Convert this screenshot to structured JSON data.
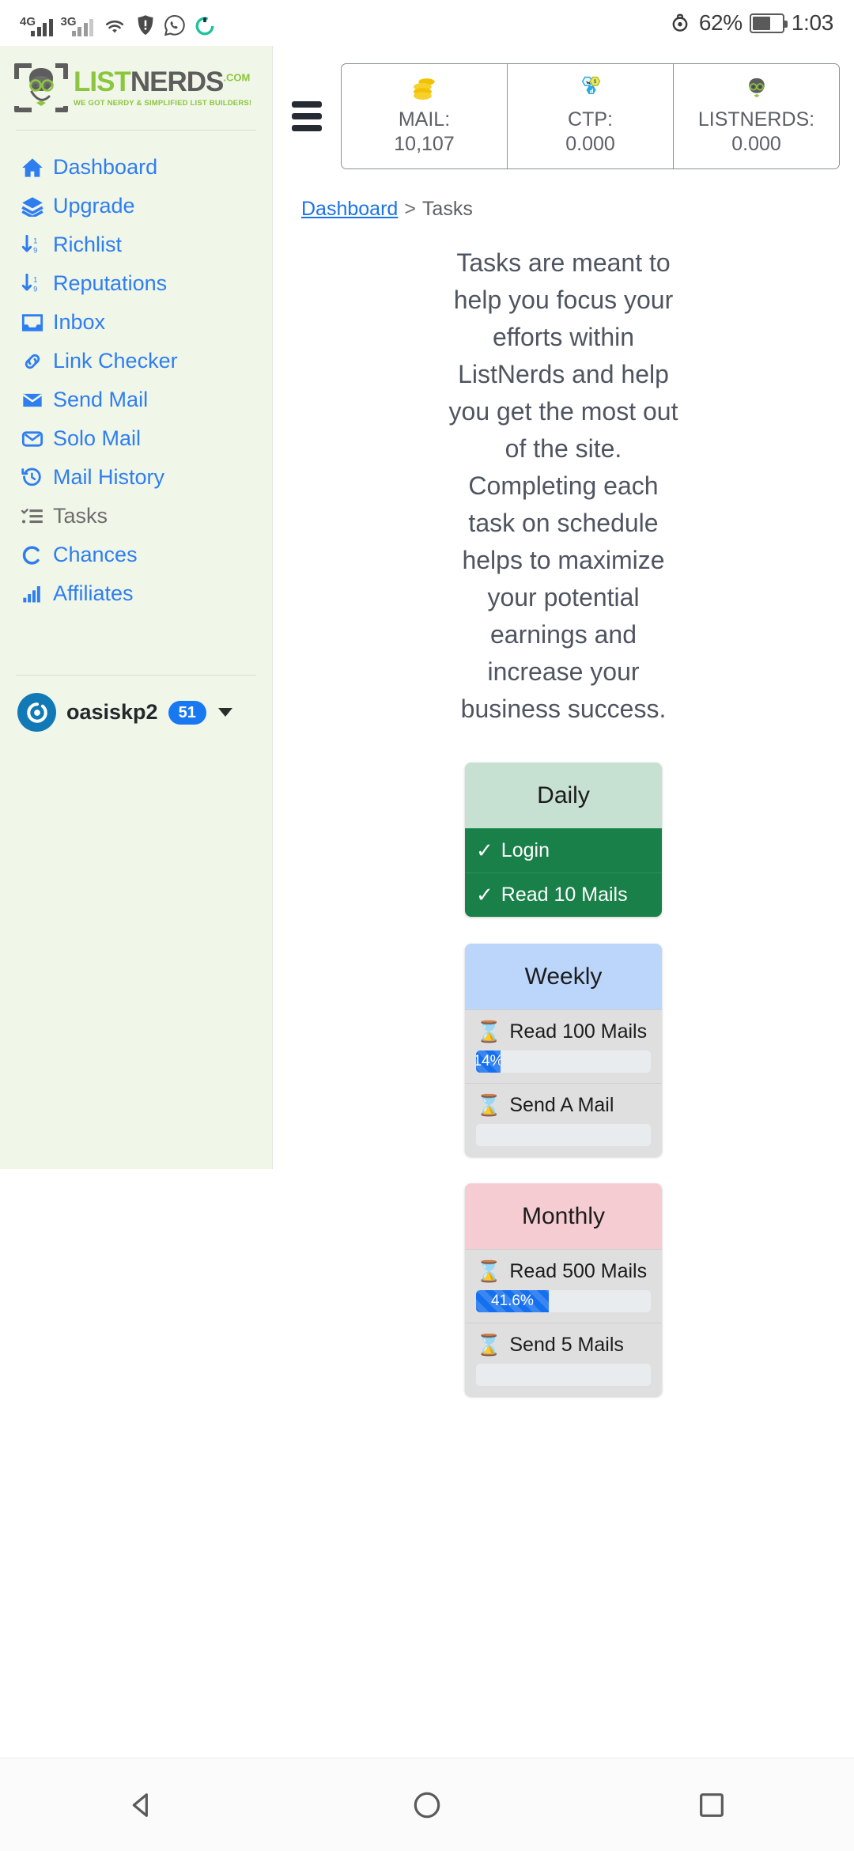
{
  "status_bar": {
    "network_1": "4G",
    "network_2": "3G",
    "icons": [
      "wifi-icon",
      "shield-icon",
      "whatsapp-icon",
      "sync-icon",
      "eye-icon"
    ],
    "battery_percent": "62%",
    "clock": "1:03"
  },
  "sidebar": {
    "logo": {
      "text_green": "LIST",
      "text_dark": "NERDS",
      "text_com": ".COM",
      "tagline": "WE GOT NERDY & SIMPLIFIED LIST BUILDERS!"
    },
    "items": [
      {
        "label": "Dashboard",
        "icon": "home-icon",
        "active": false
      },
      {
        "label": "Upgrade",
        "icon": "layers-icon",
        "active": false
      },
      {
        "label": "Richlist",
        "icon": "sort-down-icon",
        "active": false
      },
      {
        "label": "Reputations",
        "icon": "sort-down-icon",
        "active": false
      },
      {
        "label": "Inbox",
        "icon": "inbox-icon",
        "active": false
      },
      {
        "label": "Link Checker",
        "icon": "link-icon",
        "active": false
      },
      {
        "label": "Send Mail",
        "icon": "envelope-icon",
        "active": false
      },
      {
        "label": "Solo Mail",
        "icon": "envelope-open-icon",
        "active": false
      },
      {
        "label": "Mail History",
        "icon": "history-icon",
        "active": false
      },
      {
        "label": "Tasks",
        "icon": "tasks-icon",
        "active": true
      },
      {
        "label": "Chances",
        "icon": "circle-c-icon",
        "active": false
      },
      {
        "label": "Affiliates",
        "icon": "bars-chart-icon",
        "active": false
      }
    ],
    "user": {
      "name": "oasiskp2",
      "badge": "51",
      "avatar": "power-avatar-icon",
      "caret": "caret-down-icon"
    }
  },
  "topbar": {
    "menu_icon": "hamburger-icon",
    "stats": [
      {
        "icon": "coins-icon",
        "label": "MAIL:",
        "value": "10,107"
      },
      {
        "icon": "ctp-icon",
        "label": "CTP:",
        "value": "0.000"
      },
      {
        "icon": "listnerds-icon",
        "label": "LISTNERDS:",
        "value": "0.000"
      }
    ]
  },
  "breadcrumb": {
    "parent": "Dashboard",
    "separator": ">",
    "current": "Tasks"
  },
  "intro_text": "Tasks are meant to help you focus your efforts within ListNerds and help you get the most out of the site. Completing each task on schedule helps to maximize your potential earnings and increase your business success.",
  "task_cards": [
    {
      "title": "Daily",
      "tasks": [
        {
          "label": "Login",
          "state": "done",
          "icon": "check-icon",
          "progress": null
        },
        {
          "label": "Read 10 Mails",
          "state": "done",
          "icon": "check-icon",
          "progress": null
        }
      ]
    },
    {
      "title": "Weekly",
      "tasks": [
        {
          "label": "Read 100 Mails",
          "state": "pending",
          "icon": "hourglass-icon",
          "progress": {
            "percent": 14,
            "text": "14%"
          }
        },
        {
          "label": "Send A Mail",
          "state": "pending",
          "icon": "hourglass-icon",
          "progress": {
            "percent": 0,
            "text": ""
          }
        }
      ]
    },
    {
      "title": "Monthly",
      "tasks": [
        {
          "label": "Read 500 Mails",
          "state": "pending",
          "icon": "hourglass-icon",
          "progress": {
            "percent": 41.6,
            "text": "41.6%"
          }
        },
        {
          "label": "Send 5 Mails",
          "state": "pending",
          "icon": "hourglass-icon",
          "progress": {
            "percent": 0,
            "text": ""
          }
        }
      ]
    }
  ],
  "navigation_bar": {
    "back": "back-triangle-icon",
    "home": "home-circle-icon",
    "recents": "recents-square-icon"
  },
  "colors": {
    "sidebar_bg": "#f0f6e8",
    "link_blue": "#2f7ef0",
    "logo_green": "#8cc63e",
    "daily_header": "#c6e0d2",
    "weekly_header": "#bcd6fb",
    "monthly_header": "#f6ccd3",
    "done_green": "#1a8049",
    "progress_blue": "#1570ef"
  }
}
